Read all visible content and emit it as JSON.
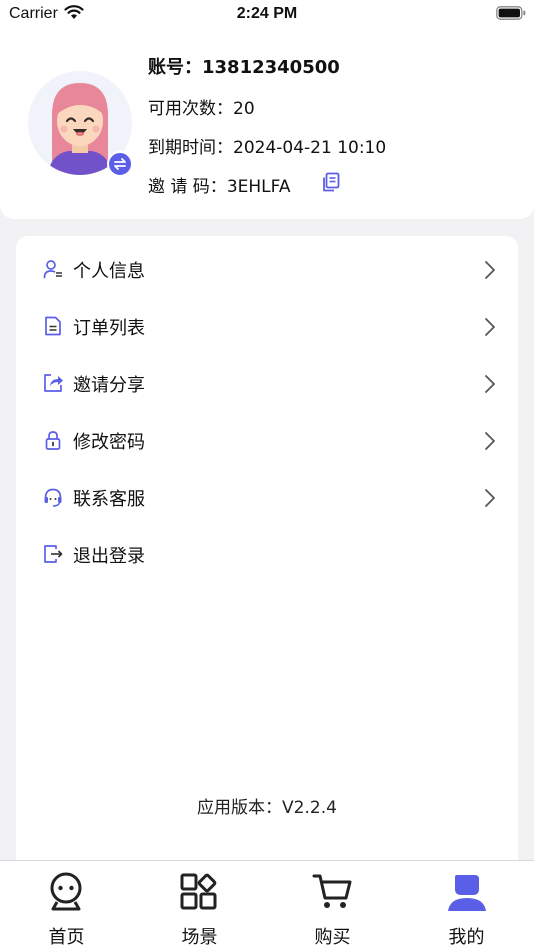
{
  "status_bar": {
    "carrier": "Carrier",
    "time": "2:24 PM"
  },
  "profile": {
    "account_label": "账号：",
    "account_value": "13812340500",
    "usable_label": "可用次数：",
    "usable_value": "20",
    "expire_label": "到期时间：",
    "expire_value": "2024-04-21 10:10",
    "invite_label": "邀 请 码：",
    "invite_value": "3EHLFA"
  },
  "menu": {
    "items": [
      {
        "label": "个人信息",
        "icon": "user-info-icon"
      },
      {
        "label": "订单列表",
        "icon": "order-list-icon"
      },
      {
        "label": "邀请分享",
        "icon": "share-icon"
      },
      {
        "label": "修改密码",
        "icon": "lock-icon"
      },
      {
        "label": "联系客服",
        "icon": "headset-icon"
      },
      {
        "label": "退出登录",
        "icon": "logout-icon"
      }
    ],
    "version": "应用版本：V2.2.4"
  },
  "tabbar": {
    "tabs": [
      {
        "label": "首页",
        "icon": "robot-icon"
      },
      {
        "label": "场景",
        "icon": "grid-icon"
      },
      {
        "label": "购买",
        "icon": "cart-icon"
      },
      {
        "label": "我的",
        "icon": "person-icon",
        "active": true
      }
    ]
  },
  "colors": {
    "accent": "#5b5fe8",
    "background": "#f2f2f4",
    "card": "#ffffff",
    "text": "#111111"
  }
}
